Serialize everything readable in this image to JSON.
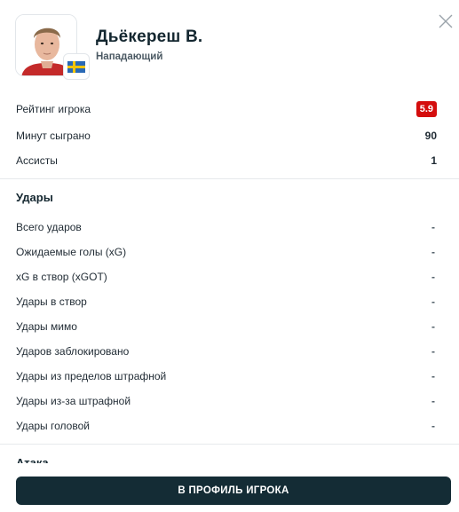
{
  "player": {
    "name": "Дьёкереш В.",
    "position": "Нападающий",
    "country_flag": "sweden-flag"
  },
  "summary": [
    {
      "label": "Рейтинг игрока",
      "value": "5.9",
      "badge_color": "#d40d0d"
    },
    {
      "label": "Минут сыграно",
      "value": "90"
    },
    {
      "label": "Ассисты",
      "value": "1"
    }
  ],
  "shots": {
    "title": "Удары",
    "rows": [
      {
        "label": "Всего ударов",
        "value": "-"
      },
      {
        "label": "Ожидаемые голы (xG)",
        "value": "-"
      },
      {
        "label": "xG в створ (xGOT)",
        "value": "-"
      },
      {
        "label": "Удары в створ",
        "value": "-"
      },
      {
        "label": "Удары мимо",
        "value": "-"
      },
      {
        "label": "Ударов заблокировано",
        "value": "-"
      },
      {
        "label": "Удары из пределов штрафной",
        "value": "-"
      },
      {
        "label": "Удары из-за штрафной",
        "value": "-"
      },
      {
        "label": "Удары головой",
        "value": "-"
      }
    ]
  },
  "next_section_title": "Атака",
  "cta_label": "В ПРОФИЛЬ ИГРОКА",
  "colors": {
    "primary_button": "#142c35",
    "rating_bad": "#d40d0d"
  }
}
